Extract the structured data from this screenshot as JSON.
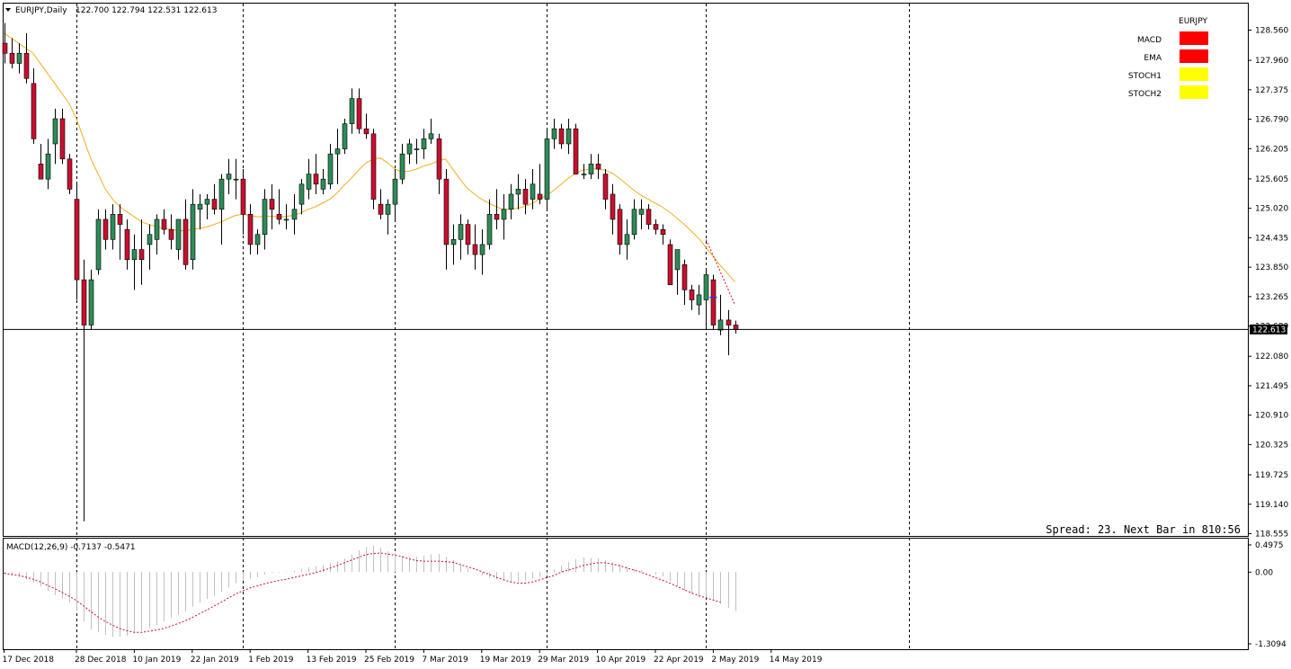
{
  "colors": {
    "bull": "#2e8b57",
    "bear": "#c8102e",
    "ema": "#f0b020",
    "signal": "#c8102e",
    "hist": "#c0c0c0",
    "status_red": "#ff0000",
    "status_yellow": "#ffff00"
  },
  "header": {
    "label": "EURJPY,Daily",
    "ohlc": "122.700 122.794 122.531 122.613"
  },
  "status_panel": {
    "title": "EURJPY",
    "rows": [
      {
        "label": "MACD",
        "color": "#ff0000"
      },
      {
        "label": "EMA",
        "color": "#ff0000"
      },
      {
        "label": "STOCH1",
        "color": "#ffff00"
      },
      {
        "label": "STOCH2",
        "color": "#ffff00"
      }
    ]
  },
  "spread_text": "Spread: 23. Next Bar in 810:56",
  "macd_label": "MACD(12,26,9) -0.7137 -0.5471",
  "chart_data": {
    "type": "candlestick",
    "price_axis": {
      "ylim": [
        118.555,
        128.85
      ],
      "ticks": [
        "128.560",
        "127.960",
        "127.375",
        "126.790",
        "126.205",
        "125.605",
        "125.020",
        "124.435",
        "123.850",
        "123.265",
        "122.680",
        "122.080",
        "121.495",
        "120.910",
        "120.325",
        "119.725",
        "119.140",
        "118.555"
      ]
    },
    "current_price": {
      "value": 122.613,
      "label": "122.613"
    },
    "date_ticks": [
      {
        "label": "17 Dec 2018",
        "index": 0
      },
      {
        "label": "28 Dec 2018",
        "index": 10
      },
      {
        "label": "10 Jan 2019",
        "index": 18
      },
      {
        "label": "22 Jan 2019",
        "index": 26
      },
      {
        "label": "1 Feb 2019",
        "index": 34
      },
      {
        "label": "13 Feb 2019",
        "index": 42
      },
      {
        "label": "25 Feb 2019",
        "index": 50
      },
      {
        "label": "7 Mar 2019",
        "index": 58
      },
      {
        "label": "19 Mar 2019",
        "index": 66
      },
      {
        "label": "29 Mar 2019",
        "index": 74
      },
      {
        "label": "10 Apr 2019",
        "index": 82
      },
      {
        "label": "22 Apr 2019",
        "index": 90
      },
      {
        "label": "2 May 2019",
        "index": 98
      },
      {
        "label": "14 May 2019",
        "index": 106
      }
    ],
    "period_separators": [
      10,
      33,
      54,
      75,
      97,
      125
    ],
    "candles": [
      [
        128.3,
        128.7,
        127.9,
        128.1
      ],
      [
        128.1,
        128.4,
        127.8,
        127.9
      ],
      [
        127.9,
        128.3,
        127.7,
        128.1
      ],
      [
        128.1,
        128.5,
        127.5,
        127.6
      ],
      [
        127.5,
        127.8,
        126.3,
        126.4
      ],
      [
        125.9,
        126.3,
        125.7,
        125.6
      ],
      [
        125.6,
        126.4,
        125.4,
        126.1
      ],
      [
        126.3,
        127.0,
        125.9,
        126.8
      ],
      [
        126.8,
        127.0,
        125.9,
        126.0
      ],
      [
        126.0,
        126.1,
        125.3,
        125.4
      ],
      [
        125.2,
        125.5,
        123.2,
        123.6
      ],
      [
        123.6,
        124.0,
        118.8,
        122.7
      ],
      [
        122.7,
        123.8,
        122.6,
        123.6
      ],
      [
        123.8,
        125.0,
        123.7,
        124.8
      ],
      [
        124.8,
        125.0,
        124.2,
        124.4
      ],
      [
        124.4,
        125.1,
        124.2,
        124.9
      ],
      [
        124.9,
        125.1,
        124.0,
        124.7
      ],
      [
        124.6,
        124.8,
        123.8,
        124.0
      ],
      [
        124.0,
        124.5,
        123.4,
        124.2
      ],
      [
        124.2,
        124.8,
        123.5,
        124.0
      ],
      [
        124.3,
        124.7,
        123.8,
        124.5
      ],
      [
        124.4,
        124.9,
        124.1,
        124.8
      ],
      [
        124.8,
        125.0,
        124.5,
        124.6
      ],
      [
        124.6,
        124.9,
        124.2,
        124.4
      ],
      [
        124.2,
        124.8,
        124.0,
        124.8
      ],
      [
        124.8,
        125.2,
        123.8,
        123.9
      ],
      [
        124.0,
        125.4,
        123.8,
        125.1
      ],
      [
        125.0,
        125.3,
        124.6,
        125.1
      ],
      [
        125.1,
        125.3,
        124.8,
        125.2
      ],
      [
        125.2,
        125.5,
        124.9,
        125.0
      ],
      [
        125.0,
        125.7,
        124.3,
        125.6
      ],
      [
        125.6,
        126.0,
        125.3,
        125.7
      ],
      [
        125.6,
        126.0,
        125.2,
        125.6
      ],
      [
        125.6,
        125.8,
        124.5,
        124.9
      ],
      [
        124.9,
        125.1,
        124.1,
        124.3
      ],
      [
        124.3,
        124.6,
        124.1,
        124.5
      ],
      [
        124.5,
        125.4,
        124.2,
        125.2
      ],
      [
        125.2,
        125.5,
        124.6,
        125.0
      ],
      [
        124.9,
        125.4,
        124.7,
        124.8
      ],
      [
        124.8,
        125.1,
        124.6,
        124.8
      ],
      [
        124.8,
        125.3,
        124.5,
        125.0
      ],
      [
        125.1,
        125.6,
        124.9,
        125.5
      ],
      [
        125.4,
        126.0,
        125.2,
        125.7
      ],
      [
        125.7,
        126.1,
        125.3,
        125.5
      ],
      [
        125.4,
        125.8,
        125.3,
        125.6
      ],
      [
        125.5,
        126.3,
        125.4,
        126.1
      ],
      [
        126.1,
        126.6,
        125.5,
        126.2
      ],
      [
        126.2,
        126.8,
        126.1,
        126.7
      ],
      [
        126.7,
        127.4,
        126.5,
        127.2
      ],
      [
        127.2,
        127.4,
        126.5,
        126.6
      ],
      [
        126.6,
        126.9,
        126.4,
        126.5
      ],
      [
        126.5,
        126.6,
        125.0,
        125.2
      ],
      [
        125.1,
        125.4,
        124.8,
        124.9
      ],
      [
        124.9,
        125.2,
        124.5,
        125.1
      ],
      [
        125.1,
        125.8,
        124.8,
        125.6
      ],
      [
        125.6,
        126.3,
        125.5,
        126.1
      ],
      [
        126.1,
        126.4,
        125.9,
        126.3
      ],
      [
        126.2,
        126.4,
        125.9,
        126.2
      ],
      [
        126.2,
        126.6,
        126.0,
        126.4
      ],
      [
        126.4,
        126.8,
        126.3,
        126.5
      ],
      [
        126.4,
        126.5,
        125.3,
        125.6
      ],
      [
        125.6,
        125.8,
        123.8,
        124.3
      ],
      [
        124.3,
        124.7,
        123.9,
        124.4
      ],
      [
        124.4,
        124.9,
        124.0,
        124.7
      ],
      [
        124.7,
        124.8,
        124.1,
        124.3
      ],
      [
        124.3,
        124.7,
        123.8,
        124.1
      ],
      [
        124.1,
        124.6,
        123.7,
        124.3
      ],
      [
        124.3,
        125.2,
        124.2,
        124.9
      ],
      [
        124.9,
        125.4,
        124.6,
        124.8
      ],
      [
        124.8,
        125.3,
        124.4,
        125.0
      ],
      [
        125.0,
        125.5,
        124.8,
        125.3
      ],
      [
        125.3,
        125.7,
        125.0,
        125.4
      ],
      [
        125.4,
        125.6,
        124.9,
        125.1
      ],
      [
        125.2,
        125.8,
        125.0,
        125.5
      ],
      [
        125.3,
        125.9,
        125.1,
        125.2
      ],
      [
        125.2,
        126.6,
        125.0,
        126.4
      ],
      [
        126.4,
        126.8,
        126.2,
        126.6
      ],
      [
        126.6,
        126.7,
        126.2,
        126.3
      ],
      [
        126.3,
        126.8,
        126.1,
        126.6
      ],
      [
        126.6,
        126.7,
        125.7,
        125.7
      ],
      [
        125.7,
        125.9,
        125.6,
        125.7
      ],
      [
        125.7,
        126.1,
        125.6,
        125.9
      ],
      [
        125.9,
        126.1,
        125.6,
        125.8
      ],
      [
        125.7,
        125.8,
        125.0,
        125.2
      ],
      [
        125.3,
        125.5,
        124.5,
        124.8
      ],
      [
        125.0,
        125.1,
        124.1,
        124.3
      ],
      [
        124.3,
        124.8,
        124.0,
        124.5
      ],
      [
        124.5,
        125.2,
        124.4,
        125.0
      ],
      [
        124.9,
        125.2,
        124.6,
        125.0
      ],
      [
        125.0,
        125.1,
        124.6,
        124.7
      ],
      [
        124.7,
        124.8,
        124.5,
        124.6
      ],
      [
        124.6,
        124.7,
        124.3,
        124.5
      ],
      [
        124.3,
        124.4,
        123.8,
        123.5
      ],
      [
        123.8,
        124.2,
        123.3,
        124.2
      ],
      [
        123.9,
        124.0,
        123.1,
        123.4
      ],
      [
        123.4,
        123.5,
        123.0,
        123.2
      ],
      [
        123.1,
        123.5,
        122.9,
        123.3
      ],
      [
        123.2,
        123.8,
        122.6,
        123.7
      ],
      [
        123.6,
        123.7,
        122.6,
        122.7
      ],
      [
        122.6,
        123.3,
        122.5,
        122.8
      ],
      [
        122.8,
        123.0,
        122.1,
        122.7
      ],
      [
        122.7,
        122.79,
        122.53,
        122.61
      ]
    ],
    "ema": [
      128.5,
      128.4,
      128.3,
      128.2,
      128.1,
      127.9,
      127.7,
      127.5,
      127.3,
      127.1,
      126.8,
      126.4,
      126.0,
      125.7,
      125.4,
      125.2,
      125.05,
      124.95,
      124.85,
      124.75,
      124.7,
      124.66,
      124.62,
      124.6,
      124.58,
      124.57,
      124.6,
      124.62,
      124.65,
      124.7,
      124.75,
      124.82,
      124.88,
      124.9,
      124.88,
      124.85,
      124.86,
      124.86,
      124.85,
      124.86,
      124.88,
      124.93,
      125.0,
      125.05,
      125.12,
      125.2,
      125.32,
      125.48,
      125.62,
      125.78,
      125.92,
      126.0,
      126.02,
      125.92,
      125.8,
      125.74,
      125.76,
      125.8,
      125.86,
      125.9,
      125.96,
      126.0,
      125.8,
      125.6,
      125.42,
      125.3,
      125.2,
      125.12,
      125.05,
      125.0,
      125.0,
      125.02,
      125.06,
      125.12,
      125.2,
      125.28,
      125.38,
      125.5,
      125.62,
      125.72,
      125.78,
      125.8,
      125.8,
      125.78,
      125.72,
      125.62,
      125.5,
      125.38,
      125.28,
      125.2,
      125.12,
      125.04,
      124.94,
      124.82,
      124.7,
      124.56,
      124.42,
      124.24,
      124.06,
      123.88,
      123.72,
      123.56
    ],
    "macd": {
      "ylim": [
        -1.3094,
        0.4975
      ],
      "ticks": [
        "0.4975",
        "0.00",
        "-1.3094"
      ],
      "histogram": [
        -0.05,
        -0.07,
        -0.09,
        -0.13,
        -0.19,
        -0.26,
        -0.34,
        -0.42,
        -0.48,
        -0.55,
        -0.7,
        -0.9,
        -1.05,
        -1.1,
        -1.15,
        -1.18,
        -1.18,
        -1.16,
        -1.12,
        -1.08,
        -1.02,
        -0.96,
        -0.9,
        -0.84,
        -0.78,
        -0.72,
        -0.63,
        -0.56,
        -0.49,
        -0.43,
        -0.36,
        -0.28,
        -0.2,
        -0.16,
        -0.12,
        -0.09,
        -0.05,
        -0.02,
        -0.01,
        0.01,
        0.03,
        0.06,
        0.09,
        0.11,
        0.13,
        0.16,
        0.2,
        0.25,
        0.33,
        0.4,
        0.46,
        0.48,
        0.45,
        0.38,
        0.33,
        0.3,
        0.28,
        0.28,
        0.3,
        0.32,
        0.33,
        0.28,
        0.22,
        0.14,
        0.07,
        0.0,
        -0.06,
        -0.1,
        -0.13,
        -0.16,
        -0.18,
        -0.17,
        -0.15,
        -0.12,
        -0.09,
        -0.04,
        0.05,
        0.12,
        0.18,
        0.24,
        0.27,
        0.26,
        0.25,
        0.22,
        0.18,
        0.14,
        0.1,
        0.06,
        0.03,
        0.0,
        -0.04,
        -0.08,
        -0.16,
        -0.24,
        -0.33,
        -0.4,
        -0.45,
        -0.48,
        -0.52,
        -0.58,
        -0.65,
        -0.71
      ],
      "signal": [
        -0.02,
        -0.04,
        -0.06,
        -0.09,
        -0.13,
        -0.18,
        -0.24,
        -0.3,
        -0.37,
        -0.44,
        -0.52,
        -0.62,
        -0.72,
        -0.82,
        -0.9,
        -0.97,
        -1.03,
        -1.07,
        -1.1,
        -1.1,
        -1.08,
        -1.06,
        -1.03,
        -0.99,
        -0.94,
        -0.89,
        -0.83,
        -0.76,
        -0.69,
        -0.62,
        -0.55,
        -0.47,
        -0.4,
        -0.34,
        -0.29,
        -0.25,
        -0.21,
        -0.18,
        -0.15,
        -0.13,
        -0.1,
        -0.07,
        -0.04,
        -0.01,
        0.03,
        0.07,
        0.12,
        0.17,
        0.22,
        0.27,
        0.32,
        0.34,
        0.35,
        0.33,
        0.31,
        0.28,
        0.24,
        0.21,
        0.2,
        0.2,
        0.2,
        0.19,
        0.18,
        0.14,
        0.1,
        0.06,
        0.01,
        -0.04,
        -0.09,
        -0.14,
        -0.18,
        -0.2,
        -0.2,
        -0.18,
        -0.14,
        -0.1,
        -0.06,
        0.0,
        0.04,
        0.08,
        0.12,
        0.15,
        0.17,
        0.17,
        0.15,
        0.12,
        0.08,
        0.04,
        0.0,
        -0.05,
        -0.1,
        -0.15,
        -0.2,
        -0.26,
        -0.32,
        -0.38,
        -0.43,
        -0.47,
        -0.51,
        -0.55
      ]
    },
    "forecast_line": [
      {
        "index": 97,
        "value": 124.4
      },
      {
        "index": 101,
        "value": 123.1
      }
    ],
    "blue_marker": {
      "index": 98,
      "value": 123.25
    }
  }
}
